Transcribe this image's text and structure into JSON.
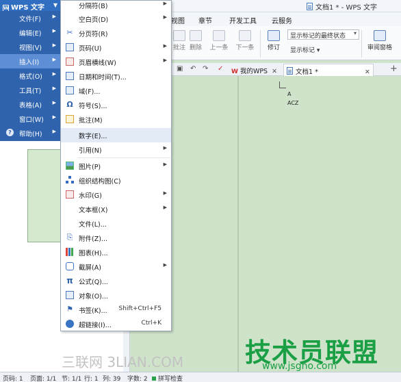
{
  "window": {
    "title": "文档1 * - WPS 文字"
  },
  "ribbon_tabs": [
    "视图",
    "章节",
    "开发工具",
    "云服务"
  ],
  "ribbon": {
    "comment": "批注",
    "delete": "删除",
    "prev": "上一条",
    "next": "下一条",
    "revise": "修订",
    "show_state_value": "显示标记的最终状态",
    "show_markup": "显示标记",
    "review_pane": "审阅窗格"
  },
  "wps_menu": {
    "label": "WPS 文字",
    "items": [
      {
        "label": "文件(F)",
        "has_submenu": true
      },
      {
        "label": "编辑(E)",
        "has_submenu": true
      },
      {
        "label": "视图(V)",
        "has_submenu": true
      },
      {
        "label": "插入(I)",
        "has_submenu": true,
        "active": true
      },
      {
        "label": "格式(O)",
        "has_submenu": true
      },
      {
        "label": "工具(T)",
        "has_submenu": true
      },
      {
        "label": "表格(A)",
        "has_submenu": true
      },
      {
        "label": "窗口(W)",
        "has_submenu": true
      },
      {
        "label": "帮助(H)",
        "has_submenu": true,
        "icon": "help-icon"
      }
    ]
  },
  "insert_menu": {
    "items": [
      {
        "label": "分隔符(B)",
        "icon": "separator-icon",
        "has_submenu": true
      },
      {
        "label": "空白页(D)",
        "icon": "blank-page-icon",
        "has_submenu": true
      },
      {
        "label": "分页符(R)",
        "icon": "page-break-icon"
      },
      {
        "label": "页码(U)",
        "icon": "page-number-icon",
        "has_submenu": true
      },
      {
        "label": "页眉横线(W)",
        "icon": "header-line-icon",
        "has_submenu": true
      },
      {
        "label": "日期和时间(T)...",
        "icon": "date-time-icon"
      },
      {
        "label": "域(F)...",
        "icon": "field-icon"
      },
      {
        "label": "符号(S)...",
        "icon": "omega-icon"
      },
      {
        "label": "批注(M)",
        "icon": "comment-icon"
      },
      {
        "label": "数字(E)...",
        "icon": "",
        "highlighted": true
      },
      {
        "label": "引用(N)",
        "icon": "",
        "has_submenu": true
      },
      {
        "label": "图片(P)",
        "icon": "picture-icon",
        "has_submenu": true
      },
      {
        "label": "组织结构图(C)",
        "icon": "org-chart-icon"
      },
      {
        "label": "水印(G)",
        "icon": "watermark-icon",
        "has_submenu": true
      },
      {
        "label": "文本框(X)",
        "icon": "",
        "has_submenu": true
      },
      {
        "label": "文件(L)...",
        "icon": ""
      },
      {
        "label": "附件(Z)...",
        "icon": "attachment-icon"
      },
      {
        "label": "图表(H)...",
        "icon": "chart-icon"
      },
      {
        "label": "截屏(A)",
        "icon": "screenshot-icon",
        "has_submenu": true
      },
      {
        "label": "公式(Q)...",
        "icon": "pi-icon"
      },
      {
        "label": "对象(O)...",
        "icon": "object-icon"
      },
      {
        "label": "书签(K)...",
        "icon": "bookmark-icon",
        "shortcut": "Shift+Ctrl+F5"
      },
      {
        "label": "超链接(I)...",
        "icon": "hyperlink-icon",
        "shortcut": "Ctrl+K"
      }
    ]
  },
  "doc_tabs": [
    {
      "label": "我的WPS",
      "icon": "wps-logo-icon"
    },
    {
      "label": "文档1 *",
      "icon": "document-icon",
      "active": true
    }
  ],
  "document": {
    "line1": "A",
    "line2": "ACZ"
  },
  "statusbar": {
    "page": "页码: 1",
    "pages": "页面: 1/1",
    "section": "节: 1/1",
    "row": "行: 1",
    "col": "列: 39",
    "words": "字数: 2",
    "spell": "拼写检查"
  },
  "watermarks": {
    "site_left": "三联网 3LIAN.COM",
    "site_right_title": "技术员联盟",
    "site_right_url": "www.jsgho.com"
  },
  "colors": {
    "menu_blue": "#2f63ad",
    "menu_active": "#5d8ed6",
    "doc_background": "#cfe3cb",
    "watermark_green": "#1a9f45"
  }
}
